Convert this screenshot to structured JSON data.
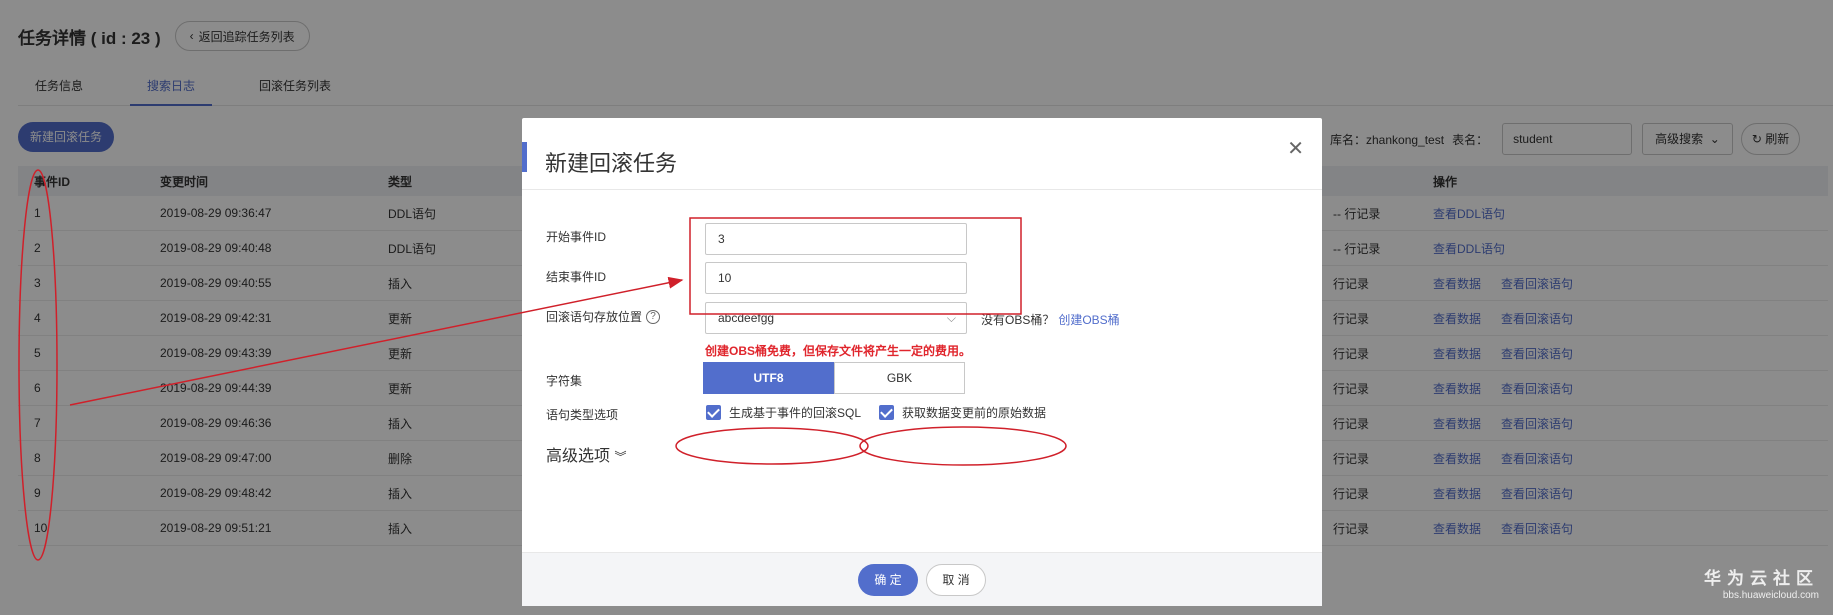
{
  "page": {
    "title": "任务详情 ( id : 23 )",
    "back_label": "返回追踪任务列表",
    "tabs": [
      {
        "label": "任务信息"
      },
      {
        "label": "搜索日志"
      },
      {
        "label": "回滚任务列表"
      }
    ],
    "new_rollback_label": "新建回滚任务",
    "filters": {
      "db_label": "库名：zhankong_test",
      "table_label": "表名：",
      "table_value": "student",
      "adv_search_label": "高级搜索",
      "refresh_label": "刷新"
    },
    "table": {
      "headers": {
        "id": "事件ID",
        "time": "变更时间",
        "type": "类型",
        "op": "操作"
      },
      "rows": [
        {
          "id": "1",
          "time": "2019-08-29 09:36:47",
          "type": "DDL语句",
          "desc": "-- 行记录",
          "ops": [
            "查看DDL语句"
          ]
        },
        {
          "id": "2",
          "time": "2019-08-29 09:40:48",
          "type": "DDL语句",
          "desc": "-- 行记录",
          "ops": [
            "查看DDL语句"
          ]
        },
        {
          "id": "3",
          "time": "2019-08-29 09:40:55",
          "type": "插入",
          "desc": "行记录",
          "ops": [
            "查看数据",
            "查看回滚语句"
          ]
        },
        {
          "id": "4",
          "time": "2019-08-29 09:42:31",
          "type": "更新",
          "desc": "行记录",
          "ops": [
            "查看数据",
            "查看回滚语句"
          ]
        },
        {
          "id": "5",
          "time": "2019-08-29 09:43:39",
          "type": "更新",
          "desc": "行记录",
          "ops": [
            "查看数据",
            "查看回滚语句"
          ]
        },
        {
          "id": "6",
          "time": "2019-08-29 09:44:39",
          "type": "更新",
          "desc": "行记录",
          "ops": [
            "查看数据",
            "查看回滚语句"
          ]
        },
        {
          "id": "7",
          "time": "2019-08-29 09:46:36",
          "type": "插入",
          "desc": "行记录",
          "ops": [
            "查看数据",
            "查看回滚语句"
          ]
        },
        {
          "id": "8",
          "time": "2019-08-29 09:47:00",
          "type": "删除",
          "desc": "行记录",
          "ops": [
            "查看数据",
            "查看回滚语句"
          ]
        },
        {
          "id": "9",
          "time": "2019-08-29 09:48:42",
          "type": "插入",
          "desc": "行记录",
          "ops": [
            "查看数据",
            "查看回滚语句"
          ]
        },
        {
          "id": "10",
          "time": "2019-08-29 09:51:21",
          "type": "插入",
          "desc": "行记录",
          "ops": [
            "查看数据",
            "查看回滚语句"
          ]
        }
      ]
    }
  },
  "dialog": {
    "title": "新建回滚任务",
    "close_icon": "close-icon",
    "start_label": "开始事件ID",
    "start_value": "3",
    "end_label": "结束事件ID",
    "end_value": "10",
    "location_label": "回滚语句存放位置",
    "location_value": "abcdeefgg",
    "no_obs_text": "没有OBS桶？",
    "create_obs_link": "创建OBS桶",
    "obs_note": "创建OBS桶免费，但保存文件将产生一定的费用。",
    "charset_label": "字符集",
    "charset_options": [
      "UTF8",
      "GBK"
    ],
    "charset_selected": "UTF8",
    "stmt_type_label": "语句类型选项",
    "option_rollback_sql": "生成基于事件的回滚SQL",
    "option_original_data": "获取数据变更前的原始数据",
    "advanced_label": "高级选项",
    "ok_label": "确 定",
    "cancel_label": "取 消"
  },
  "watermark": {
    "main": "华为云社区",
    "sub": "bbs.huaweicloud.com"
  },
  "colors": {
    "accent": "#526ecc",
    "annotation": "#d0202a"
  }
}
